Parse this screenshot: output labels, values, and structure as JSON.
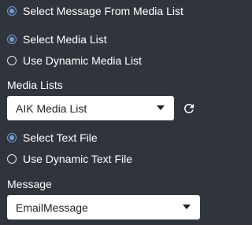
{
  "options": {
    "select_from_media_list": "Select Message From Media List",
    "select_media_list": "Select Media List",
    "use_dynamic_media_list": "Use Dynamic Media List",
    "select_text_file": "Select Text File",
    "use_dynamic_text_file": "Use Dynamic Text File"
  },
  "media_lists": {
    "label": "Media Lists",
    "selected": "AIK Media List"
  },
  "message": {
    "label": "Message",
    "selected": "EmailMessage"
  },
  "colors": {
    "background": "#30353d",
    "accent": "#6e9bd6",
    "text": "#ffffff"
  },
  "icons": {
    "refresh": "refresh-icon",
    "dropdown": "chevron-down-icon"
  }
}
